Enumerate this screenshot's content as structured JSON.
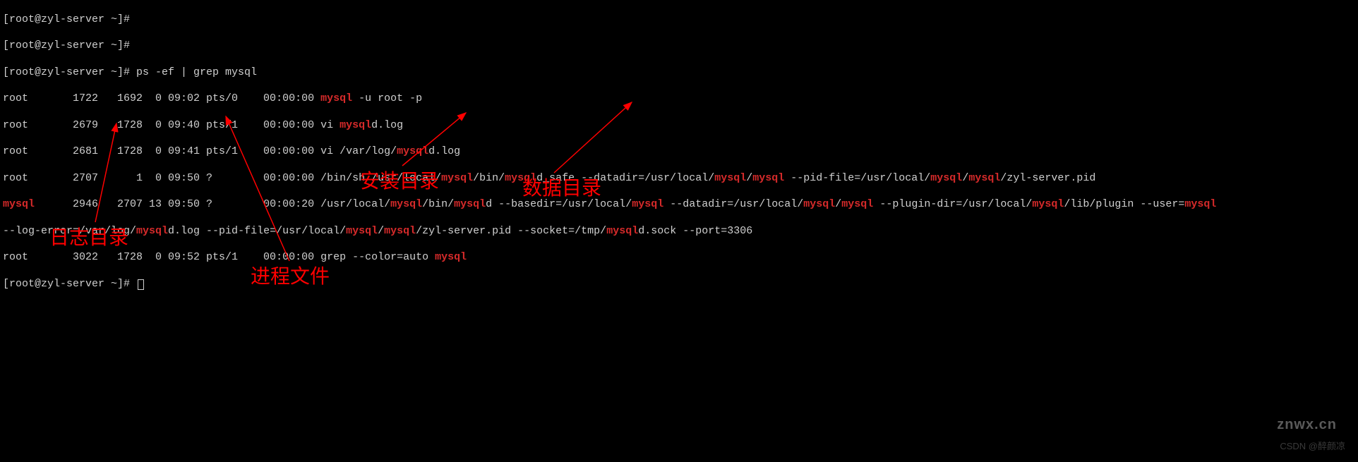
{
  "prompt_partial_top": "[root@zyl-server ~]#",
  "prompt_empty": "[root@zyl-server ~]#",
  "prompt_cmd_prefix": "[root@zyl-server ~]# ",
  "command": "ps -ef | grep mysql",
  "lines": {
    "l1_a": "root       1722   1692  0 09:02 pts/0    00:00:00 ",
    "l1_b": "mysql",
    "l1_c": " -u root -p",
    "l2_a": "root       2679   1728  0 09:40 pts/1    00:00:00 vi ",
    "l2_b": "mysql",
    "l2_c": "d.log",
    "l3_a": "root       2681   1728  0 09:41 pts/1    00:00:00 vi /var/log/",
    "l3_b": "mysql",
    "l3_c": "d.log",
    "l4_a": "root       2707      1  0 09:50 ?        00:00:00 /bin/sh /usr/local/",
    "l4_b": "mysql",
    "l4_c": "/bin/",
    "l4_d": "mysql",
    "l4_e": "d_safe --datadir=/usr/local/",
    "l4_f": "mysql",
    "l4_g": "/",
    "l4_h": "mysql",
    "l4_i": " --pid-file=/usr/local/",
    "l4_j": "mysql",
    "l4_k": "/",
    "l4_l": "mysql",
    "l4_m": "/zyl-server.pid",
    "l5_a": "mysql",
    "l5_b": "      2946   2707 13 09:50 ?        00:00:20 /usr/local/",
    "l5_c": "mysql",
    "l5_d": "/bin/",
    "l5_e": "mysql",
    "l5_f": "d --basedir=/usr/local/",
    "l5_g": "mysql",
    "l5_h": " --datadir=/usr/local/",
    "l5_i": "mysql",
    "l5_j": "/",
    "l5_k": "mysql",
    "l5_l": " --plugin-dir=/usr/local/",
    "l5_m": "mysql",
    "l5_n": "/lib/plugin --user=",
    "l5_o": "mysql",
    "l6_a": "--log-error=/var/log/",
    "l6_b": "mysql",
    "l6_c": "d.log --pid-file=/usr/local/",
    "l6_d": "mysql",
    "l6_e": "/",
    "l6_f": "mysql",
    "l6_g": "/zyl-server.pid --socket=/tmp/",
    "l6_h": "mysql",
    "l6_i": "d.sock --port=3306",
    "l7_a": "root       3022   1728  0 09:52 pts/1    00:00:00 grep --color=auto ",
    "l7_b": "mysql"
  },
  "annotations": {
    "log_dir": "日志目录",
    "process_file": "进程文件",
    "install_dir": "安装目录",
    "data_dir": "数据目录"
  },
  "watermark_logo": "znwx.cn",
  "watermark_csdn": "CSDN @醉颜凉"
}
